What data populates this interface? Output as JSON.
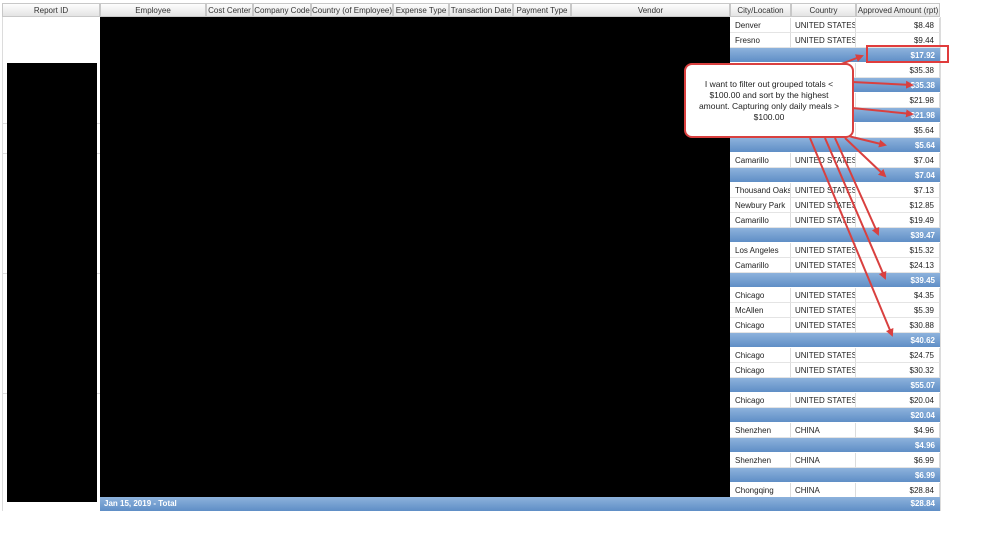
{
  "columns": {
    "report_id": "Report ID",
    "employee": "Employee",
    "cost_center": "Cost Center",
    "company_code": "Company Code",
    "country_employee": "Country (of Employee)",
    "expense_type": "Expense Type",
    "transaction_date": "Transaction Date",
    "payment_type": "Payment Type",
    "vendor": "Vendor",
    "city": "City/Location",
    "country": "Country",
    "amount": "Approved Amount (rpt)"
  },
  "rows": [
    {
      "type": "data",
      "city": "Denver",
      "country": "UNITED STATES",
      "amount": "$8.48"
    },
    {
      "type": "data",
      "city": "Fresno",
      "country": "UNITED STATES",
      "amount": "$9.44"
    },
    {
      "type": "total",
      "city": "",
      "country": "",
      "amount": "$17.92"
    },
    {
      "type": "data",
      "city": "",
      "country": "",
      "amount": "$35.38"
    },
    {
      "type": "total",
      "city": "",
      "country": "",
      "amount": "$35.38"
    },
    {
      "type": "data",
      "city": "",
      "country": "",
      "amount": "$21.98"
    },
    {
      "type": "total",
      "city": "",
      "country": "",
      "amount": "$21.98"
    },
    {
      "type": "data",
      "city": "",
      "country": "",
      "amount": "$5.64"
    },
    {
      "type": "total",
      "city": "",
      "country": "",
      "amount": "$5.64"
    },
    {
      "type": "data",
      "city": "Camarillo",
      "country": "UNITED STATES",
      "amount": "$7.04"
    },
    {
      "type": "total",
      "city": "",
      "country": "",
      "amount": "$7.04"
    },
    {
      "type": "data",
      "city": "Thousand Oaks",
      "country": "UNITED STATES",
      "amount": "$7.13"
    },
    {
      "type": "data",
      "city": "Newbury Park",
      "country": "UNITED STATES",
      "amount": "$12.85"
    },
    {
      "type": "data",
      "city": "Camarillo",
      "country": "UNITED STATES",
      "amount": "$19.49"
    },
    {
      "type": "total",
      "city": "",
      "country": "",
      "amount": "$39.47"
    },
    {
      "type": "data",
      "city": "Los Angeles",
      "country": "UNITED STATES",
      "amount": "$15.32"
    },
    {
      "type": "data",
      "city": "Camarillo",
      "country": "UNITED STATES",
      "amount": "$24.13"
    },
    {
      "type": "total",
      "city": "",
      "country": "",
      "amount": "$39.45"
    },
    {
      "type": "data",
      "city": "Chicago",
      "country": "UNITED STATES",
      "amount": "$4.35"
    },
    {
      "type": "data",
      "city": "McAllen",
      "country": "UNITED STATES",
      "amount": "$5.39"
    },
    {
      "type": "data",
      "city": "Chicago",
      "country": "UNITED STATES",
      "amount": "$30.88"
    },
    {
      "type": "total",
      "city": "",
      "country": "",
      "amount": "$40.62"
    },
    {
      "type": "data",
      "city": "Chicago",
      "country": "UNITED STATES",
      "amount": "$24.75"
    },
    {
      "type": "data",
      "city": "Chicago",
      "country": "UNITED STATES",
      "amount": "$30.32"
    },
    {
      "type": "total",
      "city": "",
      "country": "",
      "amount": "$55.07"
    },
    {
      "type": "data",
      "city": "Chicago",
      "country": "UNITED STATES",
      "amount": "$20.04"
    },
    {
      "type": "total",
      "city": "",
      "country": "",
      "amount": "$20.04"
    },
    {
      "type": "data",
      "city": "Shenzhen",
      "country": "CHINA",
      "amount": "$4.96"
    },
    {
      "type": "total",
      "city": "",
      "country": "",
      "amount": "$4.96"
    },
    {
      "type": "data",
      "city": "Shenzhen",
      "country": "CHINA",
      "amount": "$6.99"
    },
    {
      "type": "total",
      "city": "",
      "country": "",
      "amount": "$6.99"
    },
    {
      "type": "data",
      "city": "Chongqing",
      "country": "CHINA",
      "amount": "$28.84"
    }
  ],
  "grand_total": {
    "label": "Jan 15, 2019 - Total",
    "amount": "$28.84"
  },
  "callout": {
    "text": "I want to filter out grouped totals < $100.00 and sort by the highest amount. Capturing only daily meals > $100.00"
  },
  "colors": {
    "annotation_red": "#d9403f",
    "total_blue": "#6b98cc",
    "redaction": "#000000"
  }
}
